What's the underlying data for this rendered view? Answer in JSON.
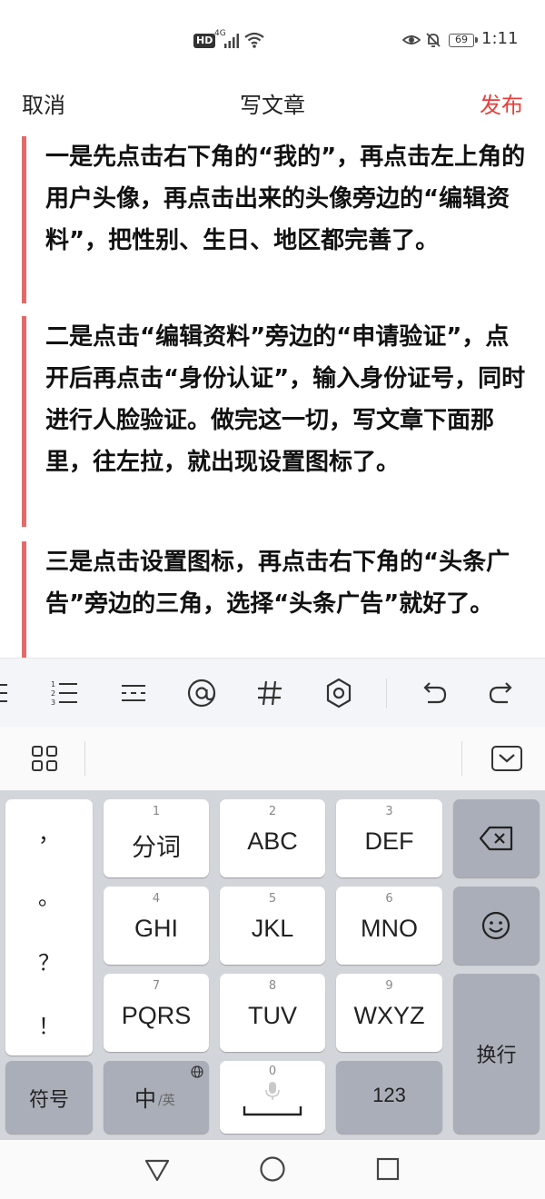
{
  "status_bar": {
    "hd": "HD",
    "network": "4G",
    "battery": "69",
    "time": "1:11"
  },
  "header": {
    "cancel": "取消",
    "title": "写文章",
    "publish": "发布",
    "publish_color": "#e5403d"
  },
  "article": {
    "paragraphs": [
      "一是先点击右下角的“我的”，再点击左上角的用户头像，再点击出来的头像旁边的“编辑资料”，把性别、生日、地区都完善了。",
      "二是点击“编辑资料”旁边的“申请验证”，点开后再点击“身份认证”，输入身份证号，同时进行人脸验证。做完这一切，写文章下面那里，往左拉，就出现设置图标了。",
      "三是点击设置图标，再点击右下角的“头条广告”旁边的三角，选择“头条广告”就好了。"
    ],
    "quote_bar_color": "#e46a6a"
  },
  "format_toolbar": {
    "icons": [
      "align-icon",
      "numbered-list-icon",
      "divider-icon",
      "mention-icon",
      "hashtag-icon",
      "settings-icon",
      "undo-icon",
      "redo-icon"
    ]
  },
  "keyboard": {
    "punctuation": [
      "，",
      "。",
      "？",
      "！"
    ],
    "keys": [
      {
        "num": "1",
        "label": "分词"
      },
      {
        "num": "2",
        "label": "ABC"
      },
      {
        "num": "3",
        "label": "DEF"
      },
      {
        "num": "4",
        "label": "GHI"
      },
      {
        "num": "5",
        "label": "JKL"
      },
      {
        "num": "6",
        "label": "MNO"
      },
      {
        "num": "7",
        "label": "PQRS"
      },
      {
        "num": "8",
        "label": "TUV"
      },
      {
        "num": "9",
        "label": "WXYZ"
      }
    ],
    "symbol": "符号",
    "lang_main": "中",
    "lang_alt": "/英",
    "space_num": "0",
    "numbers": "123",
    "enter": "换行"
  }
}
